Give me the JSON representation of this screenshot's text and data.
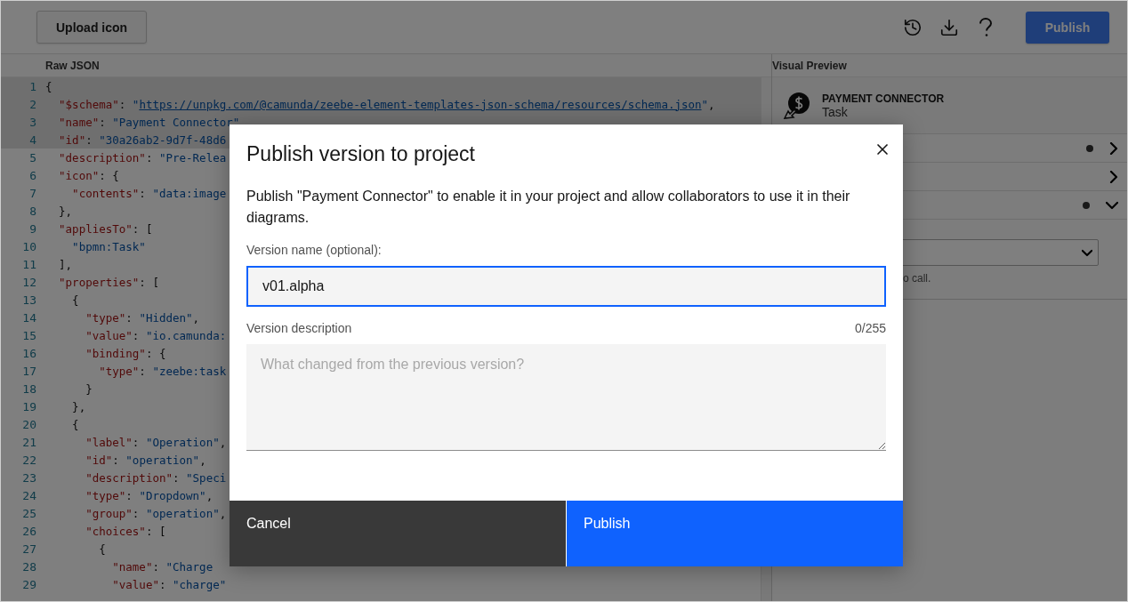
{
  "toolbar": {
    "upload_button": "Upload icon",
    "publish_button": "Publish"
  },
  "editor": {
    "title": "Raw JSON",
    "lines": [
      {
        "number": "1",
        "highlighted": true,
        "tokens": [
          {
            "kind": "punct",
            "text": "{"
          }
        ]
      },
      {
        "number": "2",
        "highlighted": true,
        "tokens": [
          {
            "kind": "key",
            "text": "  \"$schema\""
          },
          {
            "kind": "punct",
            "text": ": "
          },
          {
            "kind": "str",
            "text": "\""
          },
          {
            "kind": "link",
            "text": "https://unpkg.com/@camunda/zeebe-element-templates-json-schema/resources/schema.json"
          },
          {
            "kind": "str",
            "text": "\""
          },
          {
            "kind": "punct",
            "text": ","
          }
        ]
      },
      {
        "number": "3",
        "highlighted": true,
        "tokens": [
          {
            "kind": "key",
            "text": "  \"name\""
          },
          {
            "kind": "punct",
            "text": ": "
          },
          {
            "kind": "str",
            "text": "\"Payment Connector\""
          }
        ]
      },
      {
        "number": "4",
        "highlighted": true,
        "tokens": [
          {
            "kind": "key",
            "text": "  \"id\""
          },
          {
            "kind": "punct",
            "text": ": "
          },
          {
            "kind": "str",
            "text": "\"30a26ab2-9d7f-48d6"
          }
        ]
      },
      {
        "number": "5",
        "highlighted": false,
        "tokens": [
          {
            "kind": "key",
            "text": "  \"description\""
          },
          {
            "kind": "punct",
            "text": ": "
          },
          {
            "kind": "str",
            "text": "\"Pre-Relea"
          }
        ]
      },
      {
        "number": "6",
        "highlighted": false,
        "tokens": [
          {
            "kind": "key",
            "text": "  \"icon\""
          },
          {
            "kind": "punct",
            "text": ": {"
          }
        ]
      },
      {
        "number": "7",
        "highlighted": false,
        "tokens": [
          {
            "kind": "key",
            "text": "    \"contents\""
          },
          {
            "kind": "punct",
            "text": ": "
          },
          {
            "kind": "str",
            "text": "\"data:image"
          }
        ]
      },
      {
        "number": "8",
        "highlighted": false,
        "tokens": [
          {
            "kind": "punct",
            "text": "  },"
          }
        ]
      },
      {
        "number": "9",
        "highlighted": false,
        "tokens": [
          {
            "kind": "key",
            "text": "  \"appliesTo\""
          },
          {
            "kind": "punct",
            "text": ": ["
          }
        ]
      },
      {
        "number": "10",
        "highlighted": false,
        "tokens": [
          {
            "kind": "str",
            "text": "    \"bpmn:Task\""
          }
        ]
      },
      {
        "number": "11",
        "highlighted": false,
        "tokens": [
          {
            "kind": "punct",
            "text": "  ],"
          }
        ]
      },
      {
        "number": "12",
        "highlighted": false,
        "tokens": [
          {
            "kind": "key",
            "text": "  \"properties\""
          },
          {
            "kind": "punct",
            "text": ": ["
          }
        ]
      },
      {
        "number": "13",
        "highlighted": false,
        "tokens": [
          {
            "kind": "punct",
            "text": "    {"
          }
        ]
      },
      {
        "number": "14",
        "highlighted": false,
        "tokens": [
          {
            "kind": "key",
            "text": "      \"type\""
          },
          {
            "kind": "punct",
            "text": ": "
          },
          {
            "kind": "str",
            "text": "\"Hidden\""
          },
          {
            "kind": "punct",
            "text": ","
          }
        ]
      },
      {
        "number": "15",
        "highlighted": false,
        "tokens": [
          {
            "kind": "key",
            "text": "      \"value\""
          },
          {
            "kind": "punct",
            "text": ": "
          },
          {
            "kind": "str",
            "text": "\"io.camunda:"
          }
        ]
      },
      {
        "number": "16",
        "highlighted": false,
        "tokens": [
          {
            "kind": "key",
            "text": "      \"binding\""
          },
          {
            "kind": "punct",
            "text": ": {"
          }
        ]
      },
      {
        "number": "17",
        "highlighted": false,
        "tokens": [
          {
            "kind": "key",
            "text": "        \"type\""
          },
          {
            "kind": "punct",
            "text": ": "
          },
          {
            "kind": "str",
            "text": "\"zeebe:task"
          }
        ]
      },
      {
        "number": "18",
        "highlighted": false,
        "tokens": [
          {
            "kind": "punct",
            "text": "      }"
          }
        ]
      },
      {
        "number": "19",
        "highlighted": false,
        "tokens": [
          {
            "kind": "punct",
            "text": "    },"
          }
        ]
      },
      {
        "number": "20",
        "highlighted": false,
        "tokens": [
          {
            "kind": "punct",
            "text": "    {"
          }
        ]
      },
      {
        "number": "21",
        "highlighted": false,
        "tokens": [
          {
            "kind": "key",
            "text": "      \"label\""
          },
          {
            "kind": "punct",
            "text": ": "
          },
          {
            "kind": "str",
            "text": "\"Operation\""
          },
          {
            "kind": "punct",
            "text": ","
          }
        ]
      },
      {
        "number": "22",
        "highlighted": false,
        "tokens": [
          {
            "kind": "key",
            "text": "      \"id\""
          },
          {
            "kind": "punct",
            "text": ": "
          },
          {
            "kind": "str",
            "text": "\"operation\""
          },
          {
            "kind": "punct",
            "text": ","
          }
        ]
      },
      {
        "number": "23",
        "highlighted": false,
        "tokens": [
          {
            "kind": "key",
            "text": "      \"description\""
          },
          {
            "kind": "punct",
            "text": ": "
          },
          {
            "kind": "str",
            "text": "\"Speci"
          }
        ]
      },
      {
        "number": "24",
        "highlighted": false,
        "tokens": [
          {
            "kind": "key",
            "text": "      \"type\""
          },
          {
            "kind": "punct",
            "text": ": "
          },
          {
            "kind": "str",
            "text": "\"Dropdown\""
          },
          {
            "kind": "punct",
            "text": ","
          }
        ]
      },
      {
        "number": "25",
        "highlighted": false,
        "tokens": [
          {
            "kind": "key",
            "text": "      \"group\""
          },
          {
            "kind": "punct",
            "text": ": "
          },
          {
            "kind": "str",
            "text": "\"operation\""
          },
          {
            "kind": "punct",
            "text": ","
          }
        ]
      },
      {
        "number": "26",
        "highlighted": false,
        "tokens": [
          {
            "kind": "key",
            "text": "      \"choices\""
          },
          {
            "kind": "punct",
            "text": ": ["
          }
        ]
      },
      {
        "number": "27",
        "highlighted": false,
        "tokens": [
          {
            "kind": "punct",
            "text": "        {"
          }
        ]
      },
      {
        "number": "28",
        "highlighted": false,
        "tokens": [
          {
            "kind": "key",
            "text": "          \"name\""
          },
          {
            "kind": "punct",
            "text": ": "
          },
          {
            "kind": "str",
            "text": "\"Charge"
          }
        ]
      },
      {
        "number": "29",
        "highlighted": false,
        "tokens": [
          {
            "kind": "key",
            "text": "          \"value\""
          },
          {
            "kind": "punct",
            "text": ": "
          },
          {
            "kind": "str",
            "text": "\"charge\""
          }
        ]
      }
    ]
  },
  "preview": {
    "title": "Visual Preview",
    "element_name": "PAYMENT CONNECTOR",
    "element_type": "Task",
    "groups": [
      {
        "dot": true,
        "expanded": false
      },
      {
        "dot": false,
        "expanded": false
      },
      {
        "dot": true,
        "expanded": true
      }
    ],
    "hint": "o call."
  },
  "dialog": {
    "title": "Publish version to project",
    "body": "Publish \"Payment Connector\" to enable it in your project and allow collaborators to use it in their diagrams.",
    "name_label": "Version name (optional):",
    "name_value": "v01.alpha",
    "description_label": "Version description",
    "counter": "0/255",
    "description_placeholder": "What changed from the previous version?",
    "cancel_button": "Cancel",
    "publish_button": "Publish"
  }
}
